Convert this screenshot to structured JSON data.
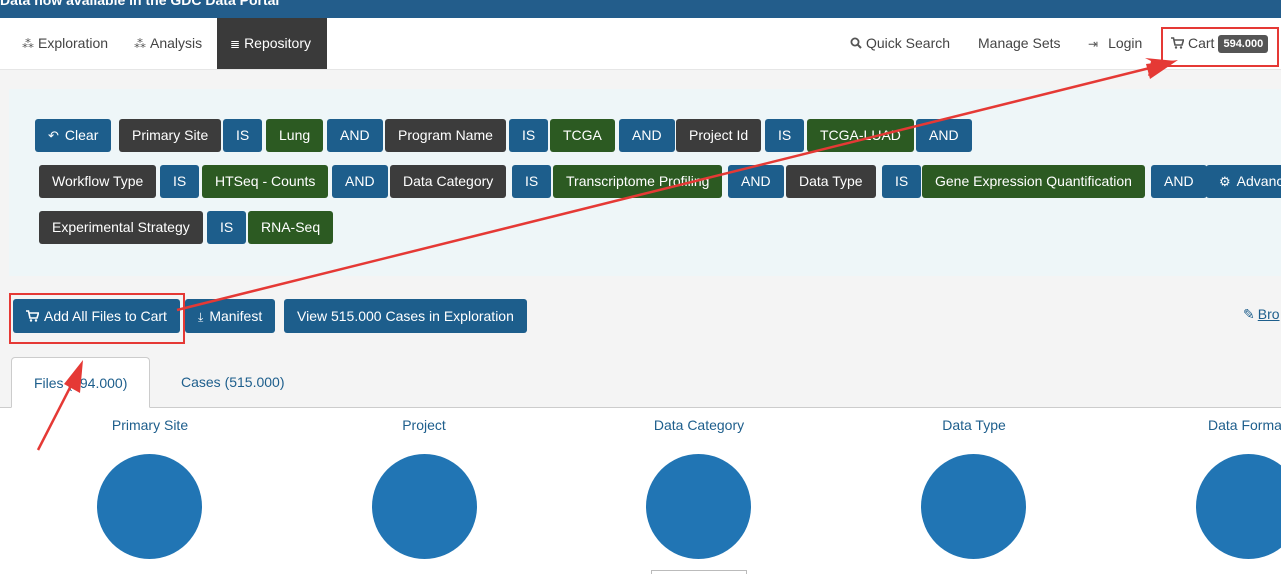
{
  "banner": {
    "text": "Data now available in the GDC Data Portal"
  },
  "nav": {
    "left": [
      {
        "label": "Exploration",
        "icon": "exploration-icon"
      },
      {
        "label": "Analysis",
        "icon": "analysis-icon"
      },
      {
        "label": "Repository",
        "icon": "database-icon",
        "active": true
      }
    ],
    "quick_search": "Quick Search",
    "manage_sets": "Manage Sets",
    "login": "Login",
    "cart_label": "Cart",
    "cart_count": "594.000"
  },
  "query": {
    "clear": "Clear",
    "row1": [
      "Primary Site",
      "IS",
      "Lung",
      "AND",
      "Program Name",
      "IS",
      "TCGA",
      "AND",
      "Project Id",
      "IS",
      "TCGA-LUAD",
      "AND"
    ],
    "row2": [
      "Workflow Type",
      "IS",
      "HTSeq - Counts",
      "AND",
      "Data Category",
      "IS",
      "Transcriptome Profiling",
      "AND",
      "Data Type",
      "IS",
      "Gene Expression Quantification",
      "AND",
      "Advanced"
    ],
    "row3": [
      "Experimental Strategy",
      "IS",
      "RNA-Seq"
    ]
  },
  "actions": {
    "add_all": "Add All Files to Cart",
    "manifest": "Manifest",
    "view_cases": "View 515.000 Cases in Exploration",
    "browse": "Bro"
  },
  "tabs": {
    "files": "Files (594.000)",
    "cases": "Cases (515.000)"
  },
  "charts": {
    "primary_site": "Primary Site",
    "project": "Project",
    "data_category": "Data Category",
    "data_type": "Data Type",
    "data_format": "Data Forma"
  },
  "colors": {
    "accent": "#1d5e8c",
    "pie": "#2175b4",
    "annotation": "#e53935"
  }
}
